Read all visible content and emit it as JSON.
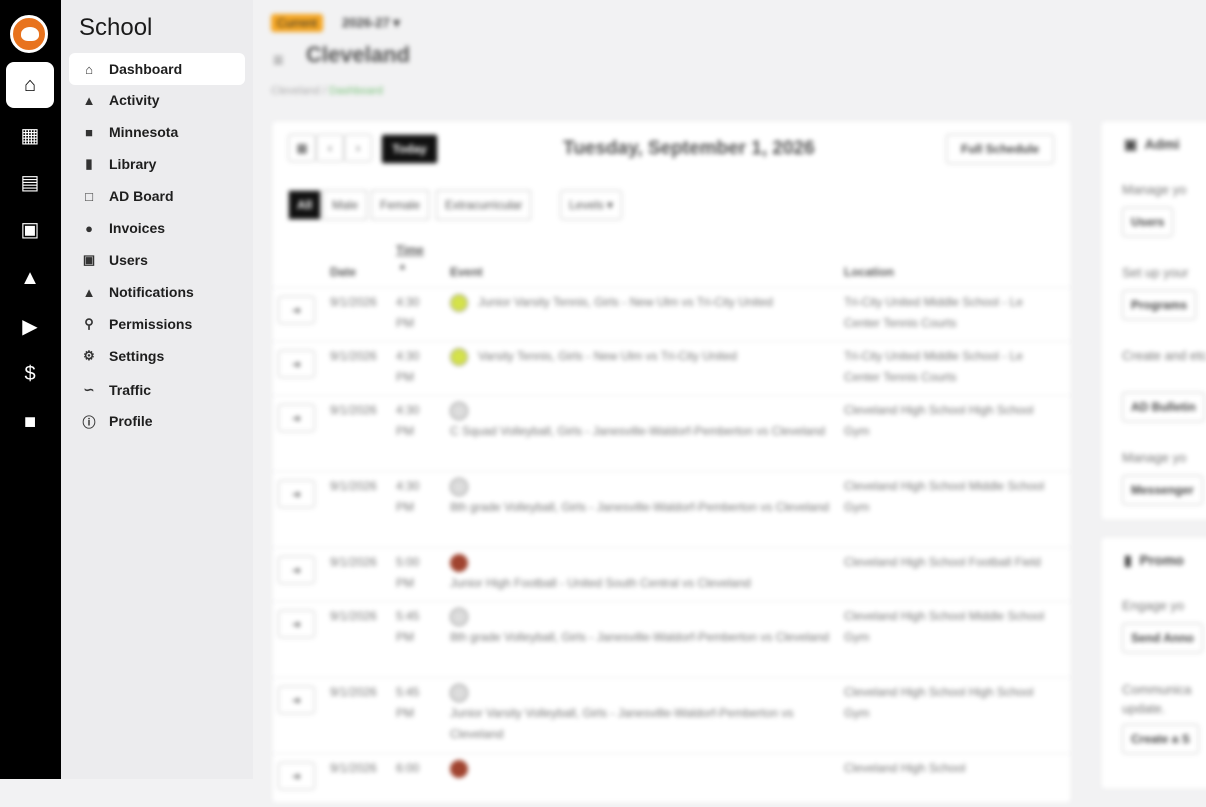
{
  "rail": [
    "home-icon",
    "calendar-icon",
    "scoreboard-icon",
    "jersey-icon",
    "graduation-cap-icon",
    "megaphone-icon",
    "dollar-icon",
    "minnesota-icon"
  ],
  "sidebar": {
    "title": "School",
    "items": [
      {
        "label": "Dashboard",
        "icon": "home-icon"
      },
      {
        "label": "Activity",
        "icon": "fire-icon"
      },
      {
        "label": "Minnesota",
        "icon": "minnesota-icon"
      },
      {
        "label": "Library",
        "icon": "books-icon"
      },
      {
        "label": "AD Board",
        "icon": "clipboard-icon"
      },
      {
        "label": "Invoices",
        "icon": "dollar-icon"
      },
      {
        "label": "Users",
        "icon": "id-card-icon"
      },
      {
        "label": "Notifications",
        "icon": "bell-icon"
      },
      {
        "label": "Permissions",
        "icon": "key-icon"
      },
      {
        "label": "Settings",
        "icon": "gear-icon"
      },
      {
        "label": "Traffic",
        "icon": "line-chart-icon"
      },
      {
        "label": "Profile",
        "icon": "info-icon"
      }
    ]
  },
  "header": {
    "badge": "Current",
    "year": "2026-27",
    "title": "Cleveland"
  },
  "breadcrumb": {
    "root": "Cleveland",
    "sep": "/",
    "current": "Dashboard"
  },
  "schedule": {
    "today": "Today",
    "date": "Tuesday, September 1, 2026",
    "full": "Full Schedule",
    "filters": [
      "All",
      "Male",
      "Female",
      "Extracurricular"
    ],
    "levels": "Levels",
    "columns": {
      "date": "Date",
      "time": "Time",
      "event": "Event",
      "location": "Location"
    },
    "rows": [
      {
        "date": "9/1/2026",
        "time": "4:30 PM",
        "sport": "tennis",
        "event": "Junior Varsity Tennis, Girls - New Ulm vs Tri-City United",
        "location": "Tri-City United Middle School - Le Center Tennis Courts"
      },
      {
        "date": "9/1/2026",
        "time": "4:30 PM",
        "sport": "tennis",
        "event": "Varsity Tennis, Girls - New Ulm vs Tri-City United",
        "location": "Tri-City United Middle School - Le Center Tennis Courts"
      },
      {
        "date": "9/1/2026",
        "time": "4:30 PM",
        "sport": "volley",
        "event": "C Squad Volleyball, Girls - Janesville-Waldorf-Pemberton vs Cleveland",
        "location": "Cleveland High School High School Gym"
      },
      {
        "date": "9/1/2026",
        "time": "4:30 PM",
        "sport": "volley",
        "event": "8th grade Volleyball, Girls - Janesville-Waldorf-Pemberton vs Cleveland",
        "location": "Cleveland High School Middle School Gym"
      },
      {
        "date": "9/1/2026",
        "time": "5:00 PM",
        "sport": "foot",
        "event": "Junior High Football - United South Central vs Cleveland",
        "location": "Cleveland High School Football Field"
      },
      {
        "date": "9/1/2026",
        "time": "5:45 PM",
        "sport": "volley",
        "event": "8th grade Volleyball, Girls - Janesville-Waldorf-Pemberton vs Cleveland",
        "location": "Cleveland High School Middle School Gym"
      },
      {
        "date": "9/1/2026",
        "time": "5:45 PM",
        "sport": "volley",
        "event": "Junior Varsity Volleyball, Girls - Janesville-Waldorf-Pemberton vs Cleveland",
        "location": "Cleveland High School High School Gym"
      },
      {
        "date": "9/1/2026",
        "time": "6:00",
        "sport": "foot",
        "event": "",
        "location": "Cleveland High School"
      }
    ]
  },
  "admin": {
    "title": "Admi",
    "items": [
      {
        "text": "Manage yo",
        "button": "Users"
      },
      {
        "text": "Set up your",
        "button": "Programs"
      },
      {
        "text": "Create and etc.",
        "button": "AD Bulletin"
      },
      {
        "text": "Manage yo",
        "button": "Messenger"
      }
    ]
  },
  "promo": {
    "title": "Promo",
    "items": [
      {
        "text": "Engage yo",
        "button": "Send Anno"
      },
      {
        "text": "Communica update.",
        "button": "Create a S"
      }
    ]
  }
}
